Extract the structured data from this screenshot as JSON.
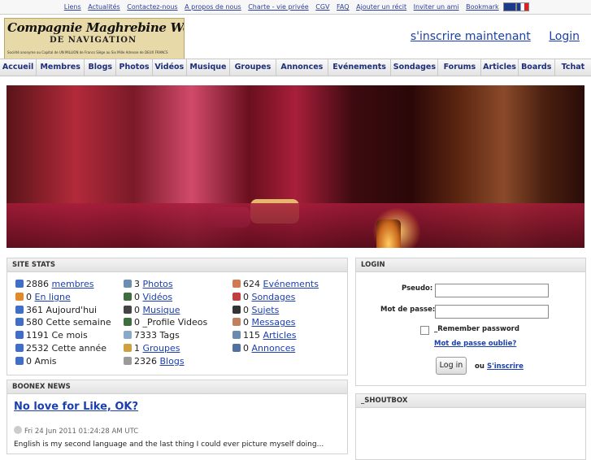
{
  "toplinks": [
    "Liens",
    "Actualités",
    "Contactez-nous",
    "A propos de nous",
    "Charte - vie privée",
    "CGV",
    "FAQ",
    "Ajouter un récit",
    "Inviter un ami",
    "Bookmark"
  ],
  "logo": {
    "line1": "Compagnie Maghrebine Wechwech",
    "line2": "DE NAVIGATION",
    "line3": "Société anonyme au Capital de UN MILLION de Francs Siège au Six Mille Adresse de DEUX FRANCS"
  },
  "header": {
    "register": "s'inscrire maintenant",
    "login": "Login"
  },
  "menu": [
    "Accueil",
    "Membres",
    "Blogs",
    "Photos",
    "Vidéos",
    "Musique",
    "Groupes",
    "Annonces",
    "Evénements",
    "Sondages",
    "Forums",
    "Articles",
    "Boards",
    "Tchat"
  ],
  "stats": {
    "title": "SITE STATS",
    "col1": [
      {
        "icon": "user-icon",
        "count": "2886",
        "label": "membres",
        "link": true
      },
      {
        "icon": "user-online-icon",
        "count": "0",
        "label": "En ligne",
        "link": true
      },
      {
        "icon": "user-icon",
        "count": "361",
        "label": "Aujourd'hui",
        "link": false
      },
      {
        "icon": "user-icon",
        "count": "580",
        "label": "Cette semaine",
        "link": false
      },
      {
        "icon": "user-icon",
        "count": "1191",
        "label": "Ce mois",
        "link": false
      },
      {
        "icon": "user-icon",
        "count": "2532",
        "label": "Cette année",
        "link": false
      },
      {
        "icon": "user-icon",
        "count": "0",
        "label": "Amis",
        "link": false
      }
    ],
    "col2": [
      {
        "icon": "photo-icon",
        "count": "3",
        "label": "Photos",
        "link": true
      },
      {
        "icon": "film-icon",
        "count": "0",
        "label": "Vidéos",
        "link": true
      },
      {
        "icon": "music-icon",
        "count": "0",
        "label": "Musique",
        "link": true
      },
      {
        "icon": "film-icon",
        "count": "0",
        "label": "_Profile Videos",
        "link": false
      },
      {
        "icon": "tag-icon",
        "count": "7333",
        "label": "Tags",
        "link": false
      },
      {
        "icon": "group-icon",
        "count": "1",
        "label": "Groupes",
        "link": true
      },
      {
        "icon": "blog-icon",
        "count": "2326",
        "label": "Blogs",
        "link": true
      }
    ],
    "col3": [
      {
        "icon": "calendar-icon",
        "count": "624",
        "label": "Evénements",
        "link": true
      },
      {
        "icon": "poll-icon",
        "count": "0",
        "label": "Sondages",
        "link": true
      },
      {
        "icon": "topic-icon",
        "count": "0",
        "label": "Sujets",
        "link": true
      },
      {
        "icon": "message-icon",
        "count": "0",
        "label": "Messages",
        "link": true
      },
      {
        "icon": "article-icon",
        "count": "115",
        "label": "Articles",
        "link": true
      },
      {
        "icon": "car-icon",
        "count": "0",
        "label": "Annonces",
        "link": true
      }
    ]
  },
  "login": {
    "title": "LOGIN",
    "pseudo_label": "Pseudo:",
    "password_label": "Mot de passe:",
    "remember": "_Remember password",
    "forgot": "Mot de passe oublie?",
    "button": "Log in",
    "or": "ou",
    "register": "S'inscrire"
  },
  "news": {
    "title": "BOONEX NEWS",
    "headline": "No love for Like, OK?",
    "date": "Fri 24 Jun 2011 01:24:28 AM UTC",
    "body": "English is my second language and the last thing I could ever picture myself doing..."
  },
  "shoutbox": {
    "title": "_SHOUTBOX"
  },
  "colors": {
    "link": "#1a3fb0",
    "menu_text": "#1d2f7a"
  }
}
